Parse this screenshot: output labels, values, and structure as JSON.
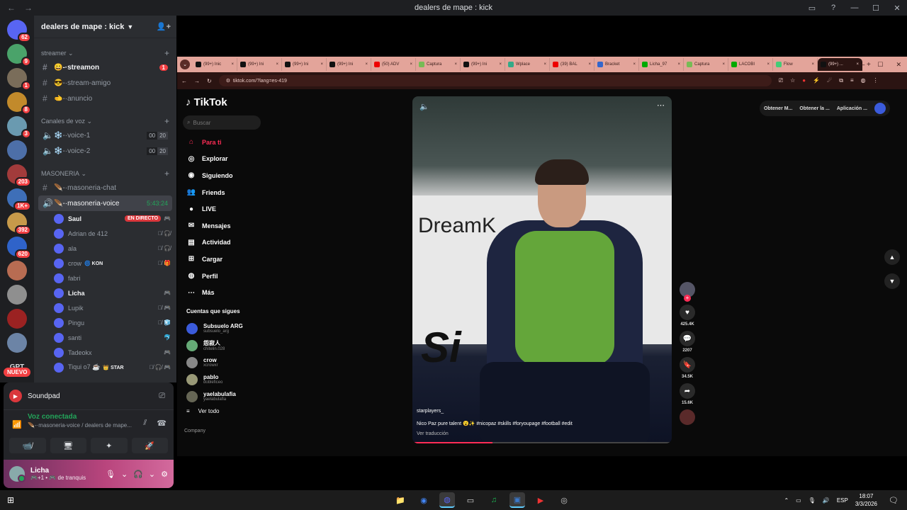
{
  "window": {
    "title": "dealers de mape : kick",
    "back_icon": "←",
    "forward_icon": "→",
    "controls": [
      "▭",
      "?",
      "—",
      "☐",
      "✕"
    ]
  },
  "rail": {
    "servers": [
      {
        "badge": "62",
        "color": "#5865f2"
      },
      {
        "badge": "9",
        "color": "#4aa36a"
      },
      {
        "badge": "1",
        "color": "#7a6d5a"
      },
      {
        "badge": "8",
        "color": "#c28a2b"
      },
      {
        "badge": "3",
        "color": "#6a9ab0"
      },
      {
        "badge": "",
        "color": "#4d6fa8"
      },
      {
        "badge": "203",
        "color": "#a23b3b"
      },
      {
        "badge": "1K+",
        "color": "#3e6fb8"
      },
      {
        "badge": "392",
        "color": "#c79a4a"
      },
      {
        "badge": "620",
        "color": "#2f63c9"
      },
      {
        "badge": "",
        "color": "#b86c52"
      },
      {
        "badge": "",
        "color": "#8f8f8f"
      },
      {
        "badge": "",
        "color": "#9b2222"
      },
      {
        "badge": "",
        "color": "#6c84a6"
      }
    ],
    "gpt_label": "GPT",
    "nuevo_label": "NUEVO"
  },
  "guild": {
    "name": "dealers de mape : kick",
    "categories": {
      "streamer": "streamer",
      "voice": "Canales de voz",
      "masoneria": "MASONERIA"
    },
    "channels": {
      "streamon": {
        "label": "😀-·streamon",
        "count": "1"
      },
      "stream_amigo": {
        "label": "😎-·stream-amigo"
      },
      "anuncio": {
        "label": "🫲-·anuncio"
      },
      "voice1": {
        "label": "❄️-·voice-1",
        "lim_a": "00",
        "lim_b": "20"
      },
      "voice2": {
        "label": "❄️-·voice-2",
        "lim_a": "00",
        "lim_b": "20"
      },
      "masoneria_chat": {
        "label": "🪶-·masoneria-chat"
      },
      "masoneria_voice": {
        "label": "🪶-·masoneria-voice",
        "timer": "5:43:24"
      }
    },
    "voice_users": [
      {
        "name": "Saul",
        "bright": true,
        "live": "EN DIRECTO",
        "icons": "🎮"
      },
      {
        "name": "Adrian de 412",
        "icons": "🎙̸ 🎧̸"
      },
      {
        "name": "ala",
        "icons": "🎙̸ 🎧̸"
      },
      {
        "name": "crow",
        "tag": "🌀 KON",
        "icons": "🎙̸ 🎁"
      },
      {
        "name": "fabri",
        "icons": ""
      },
      {
        "name": "Licha",
        "bright": true,
        "icons": "🎮"
      },
      {
        "name": "Lupik",
        "icons": "🎙̸ 🎮"
      },
      {
        "name": "Pingu",
        "icons": "🎙̸ 🧊"
      },
      {
        "name": "santi",
        "icons": "🐬"
      },
      {
        "name": "Tadeokx",
        "icons": "🎮"
      },
      {
        "name": "Tiqui o7 ☕",
        "tag": "👑 STAR",
        "icons": "🎙̸ 🎧̸ 🎮"
      }
    ]
  },
  "panel": {
    "soundpad": "Soundpad",
    "voice_status": "Voz conectada",
    "voice_channel": "🪶-·masoneria-voice / dealers de mape...",
    "buttons": [
      "📹̸",
      "🖥",
      "✦",
      "🚀"
    ],
    "user_name": "Licha",
    "user_status": "🎮+1 • 🎮 de tranquis"
  },
  "browser": {
    "tabs": [
      {
        "label": "(99+) Inic",
        "color": "#111"
      },
      {
        "label": "(99+) Ini",
        "color": "#111"
      },
      {
        "label": "(99+) Ini",
        "color": "#111"
      },
      {
        "label": "(99+) Ini",
        "color": "#111"
      },
      {
        "label": "(50) ADV",
        "color": "#e00"
      },
      {
        "label": "Captura",
        "color": "#7b5"
      },
      {
        "label": "(99+) Ini",
        "color": "#111"
      },
      {
        "label": "Wplace",
        "color": "#3a8"
      },
      {
        "label": "(39) BAL",
        "color": "#e00"
      },
      {
        "label": "Bracket",
        "color": "#36c"
      },
      {
        "label": "Licha_97",
        "color": "#0a0"
      },
      {
        "label": "Captura",
        "color": "#7b5"
      },
      {
        "label": "LACOBI",
        "color": "#0a0"
      },
      {
        "label": "Flow",
        "color": "#4c7"
      },
      {
        "label": "(99+) ...",
        "color": "#111",
        "active": true
      }
    ],
    "url": "tiktok.com/?lang=es-419"
  },
  "tiktok": {
    "logo": "TikTok",
    "search_placeholder": "Buscar",
    "nav": [
      {
        "label": "Para ti",
        "icon": "⌂",
        "active": true
      },
      {
        "label": "Explorar",
        "icon": "◎"
      },
      {
        "label": "Siguiendo",
        "icon": "◉"
      },
      {
        "label": "Friends",
        "icon": "👥"
      },
      {
        "label": "LIVE",
        "icon": "●"
      },
      {
        "label": "Mensajes",
        "icon": "✉"
      },
      {
        "label": "Actividad",
        "icon": "▤"
      },
      {
        "label": "Cargar",
        "icon": "⊞"
      },
      {
        "label": "Perfil",
        "icon": "◍"
      },
      {
        "label": "Más",
        "icon": "⋯"
      }
    ],
    "following_header": "Cuentas que sigues",
    "following": [
      {
        "name": "Subsuelo ARG",
        "handle": "subsuelo_arg"
      },
      {
        "name": "怨寂人",
        "handle": "chitelin.028"
      },
      {
        "name": "crow",
        "handle": "xcrowxr"
      },
      {
        "name": "pablo",
        "handle": "dobleficeo"
      },
      {
        "name": "yaelabulafia",
        "handle": "yaelabulafia"
      }
    ],
    "see_all": "Ver todo",
    "company": "Company",
    "video": {
      "brand_text": "DreamK",
      "scrawl": "Si",
      "username": "starplayers_",
      "caption": "Nico Paz pure talent 😮✨ #nicopaz #skills #foryoupage #football #edit",
      "translate": "Ver traducción",
      "progress": 0.31
    },
    "actions": {
      "likes": "425.4K",
      "comments": "2207",
      "saves": "34.5K",
      "shares": "15.6K"
    },
    "topbar": [
      "Obtener M...",
      "Obtener la ...",
      "Aplicación ..."
    ]
  },
  "taskbar": {
    "apps": [
      "📁",
      "◉",
      "◍",
      "▭",
      "♫",
      "▣",
      "▶",
      "◎"
    ],
    "lang": "ESP",
    "time": "18:07",
    "date": "3/3/2026"
  }
}
